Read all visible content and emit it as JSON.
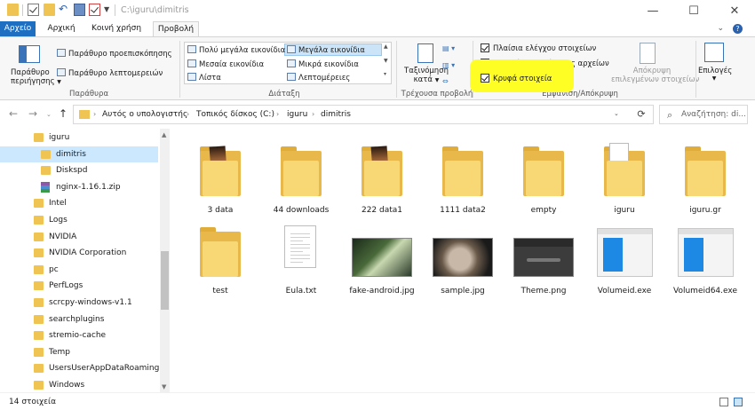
{
  "window": {
    "title_path": "C:\\iguru\\dimitris",
    "minimize": "—",
    "maximize": "☐",
    "close": "✕"
  },
  "tabs": [
    {
      "label": "Αρχείο"
    },
    {
      "label": "Αρχική"
    },
    {
      "label": "Κοινή χρήση"
    },
    {
      "label": "Προβολή"
    }
  ],
  "ribbon": {
    "panes": {
      "nav_pane_line1": "Παράθυρο",
      "nav_pane_line2": "περιήγησης",
      "preview_pane": "Παράθυρο προεπισκόπησης",
      "details_pane": "Παράθυρο λεπτομερειών",
      "group_label": "Παράθυρα"
    },
    "layout": {
      "very_large_icons": "Πολύ μεγάλα εικονίδια",
      "large_icons": "Μεγάλα εικονίδια",
      "medium_icons": "Μεσαία εικονίδια",
      "small_icons": "Μικρά εικονίδια",
      "list": "Λίστα",
      "details": "Λεπτομέρειες",
      "group_label": "Διάταξη"
    },
    "current_view": {
      "sort_line1": "Ταξινόμηση",
      "sort_line2": "κατά",
      "group_label": "Τρέχουσα προβολή"
    },
    "show_hide": {
      "item_checkboxes": "Πλαίσια ελέγχου στοιχείων",
      "file_extensions": "Επεκτάσεις ονόματος αρχείων",
      "hidden_items": "Κρυφά στοιχεία",
      "hide_selected_line1": "Απόκρυψη",
      "hide_selected_line2": "επιλεγμένων στοιχείων",
      "group_label": "Εμφάνιση/Απόκρυψη"
    },
    "options": "Επιλογές"
  },
  "address": {
    "crumbs": [
      "Αυτός ο υπολογιστής",
      "Τοπικός δίσκος (C:)",
      "iguru",
      "dimitris"
    ],
    "search_placeholder": "Αναζήτηση: di..."
  },
  "nav_items": [
    {
      "label": "iguru",
      "kind": "folder"
    },
    {
      "label": "dimitris",
      "kind": "folder",
      "selected": true
    },
    {
      "label": "Diskspd",
      "kind": "folder"
    },
    {
      "label": "nginx-1.16.1.zip",
      "kind": "zip"
    },
    {
      "label": "Intel",
      "kind": "folder"
    },
    {
      "label": "Logs",
      "kind": "folder"
    },
    {
      "label": "NVIDIA",
      "kind": "folder"
    },
    {
      "label": "NVIDIA Corporation",
      "kind": "folder"
    },
    {
      "label": "pc",
      "kind": "folder"
    },
    {
      "label": "PerfLogs",
      "kind": "folder"
    },
    {
      "label": "scrcpy-windows-v1.1",
      "kind": "folder"
    },
    {
      "label": "searchplugins",
      "kind": "folder"
    },
    {
      "label": "stremio-cache",
      "kind": "folder"
    },
    {
      "label": "Temp",
      "kind": "folder"
    },
    {
      "label": "UsersUserAppDataRoaming",
      "kind": "folder"
    },
    {
      "label": "Windows",
      "kind": "folder"
    }
  ],
  "files": [
    {
      "name": "3 data",
      "kind": "folder-photo"
    },
    {
      "name": "44 downloads",
      "kind": "folder"
    },
    {
      "name": "222 data1",
      "kind": "folder-photo"
    },
    {
      "name": "1111 data2",
      "kind": "folder"
    },
    {
      "name": "empty",
      "kind": "folder"
    },
    {
      "name": "iguru",
      "kind": "folder-doc"
    },
    {
      "name": "iguru.gr",
      "kind": "folder"
    },
    {
      "name": "test",
      "kind": "folder"
    },
    {
      "name": "Eula.txt",
      "kind": "text"
    },
    {
      "name": "fake-android.jpg",
      "kind": "image"
    },
    {
      "name": "sample.jpg",
      "kind": "image"
    },
    {
      "name": "Theme.png",
      "kind": "image"
    },
    {
      "name": "Volumeid.exe",
      "kind": "exe"
    },
    {
      "name": "Volumeid64.exe",
      "kind": "exe"
    }
  ],
  "status": {
    "count": "14 στοιχεία"
  },
  "colors": {
    "accent": "#1e6fc2",
    "highlight": "#fffe24",
    "folder": "#f8d775"
  }
}
